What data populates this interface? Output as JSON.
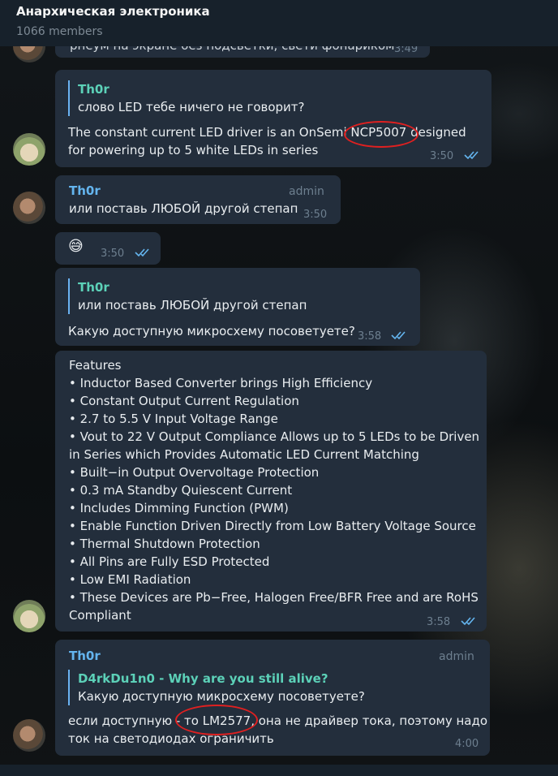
{
  "header": {
    "title": "Анархическая электроника",
    "subtitle": "1066 members"
  },
  "messages": {
    "m0": {
      "text": "рнеум на экране без подсветки, свети фонариком",
      "time": "3:49"
    },
    "m1": {
      "quote_name": "Th0r",
      "quote_text": "слово LED тебе ничего не говорит?",
      "line1": "The constant current LED driver is an OnSemi NCP5007 designed",
      "line2": "for powering up to 5 white LEDs in series",
      "time": "3:50"
    },
    "m2": {
      "sender": "Th0r",
      "badge": "admin",
      "text": "или поставь ЛЮБОЙ другой степап",
      "time": "3:50"
    },
    "m3": {
      "emoji": "😅",
      "time": "3:50"
    },
    "m4": {
      "quote_name": "Th0r",
      "quote_text": "или поставь ЛЮБОЙ другой степап",
      "text": "Какую доступную микросхему посоветуете?",
      "time": "3:58"
    },
    "m5": {
      "lines": [
        "Features",
        "• Inductor Based Converter brings High Efficiency",
        "• Constant Output Current Regulation",
        "• 2.7 to 5.5 V Input Voltage Range",
        "• Vout to 22 V Output Compliance Allows up to 5 LEDs to be Driven",
        "in Series which Provides Automatic LED Current Matching",
        "• Built−in Output Overvoltage Protection",
        "• 0.3 mA Standby Quiescent Current",
        "• Includes Dimming Function (PWM)",
        "• Enable Function Driven Directly from Low Battery Voltage Source",
        "• Thermal Shutdown Protection",
        "• All Pins are Fully ESD Protected",
        "• Low EMI Radiation",
        "• These Devices are Pb−Free, Halogen Free/BFR Free and are RoHS",
        "Compliant"
      ],
      "time": "3:58"
    },
    "m6": {
      "sender": "Th0r",
      "badge": "admin",
      "quote_name": "D4rkDu1n0 - Why are you still alive?",
      "quote_text": "Какую доступную микросхему посоветуете?",
      "line1": "если доступную - то LM2577, она не драйвер тока, поэтому надо",
      "line2": "ток на светодиодах ограничить",
      "time": "4:00"
    }
  },
  "colors": {
    "bubble": "#232e3c",
    "header": "#17212b",
    "accent": "#64b5ef",
    "quote_name": "#5cd1b8",
    "annotation": "#e02020"
  },
  "icons": {
    "read": "double-check-icon"
  }
}
